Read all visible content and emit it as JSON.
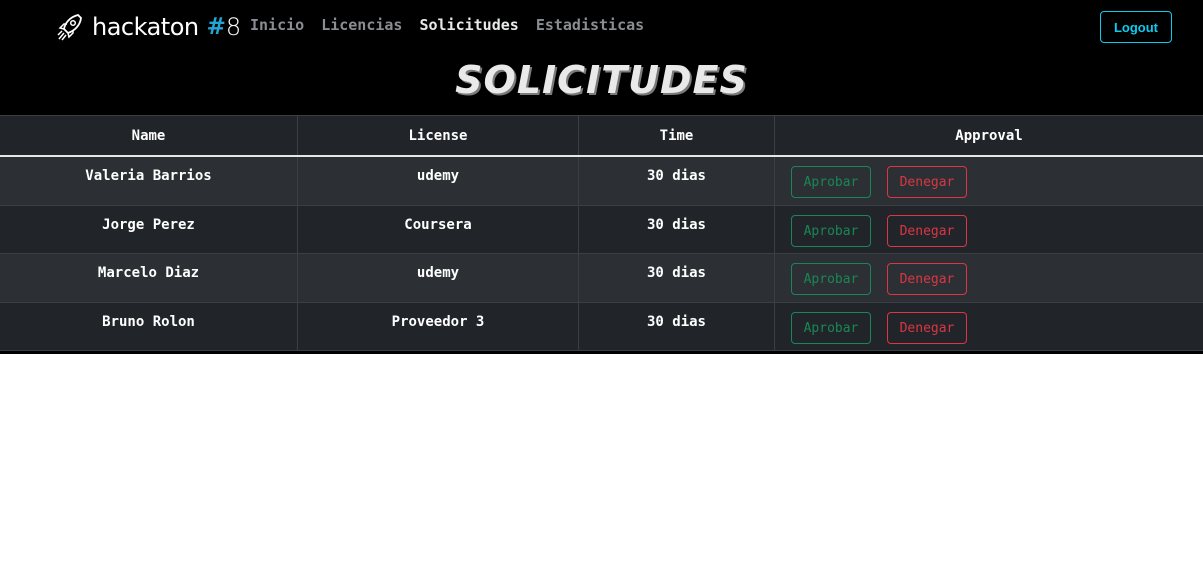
{
  "brand": {
    "name": "hackaton",
    "hash": "#",
    "number": "8",
    "icon": "rocket-icon"
  },
  "nav": {
    "links": [
      {
        "label": "Inicio",
        "active": false
      },
      {
        "label": "Licencias",
        "active": false
      },
      {
        "label": "Solicitudes",
        "active": true
      },
      {
        "label": "Estadisticas",
        "active": false
      }
    ],
    "logout_label": "Logout"
  },
  "page": {
    "title": "SOLICITUDES"
  },
  "table": {
    "headers": [
      "Name",
      "License",
      "Time",
      "Approval"
    ],
    "rows": [
      {
        "name": "Valeria Barrios",
        "license": "udemy",
        "time": "30 dias"
      },
      {
        "name": "Jorge Perez",
        "license": "Coursera",
        "time": "30 dias"
      },
      {
        "name": "Marcelo Diaz",
        "license": "udemy",
        "time": "30 dias"
      },
      {
        "name": "Bruno Rolon",
        "license": "Proveedor 3",
        "time": "30 dias"
      }
    ],
    "approve_label": "Aprobar",
    "deny_label": "Denegar"
  },
  "colors": {
    "accent": "#0dcaf0",
    "approve": "#198754",
    "deny": "#dc3545",
    "brand_hash": "#23a6d5"
  }
}
